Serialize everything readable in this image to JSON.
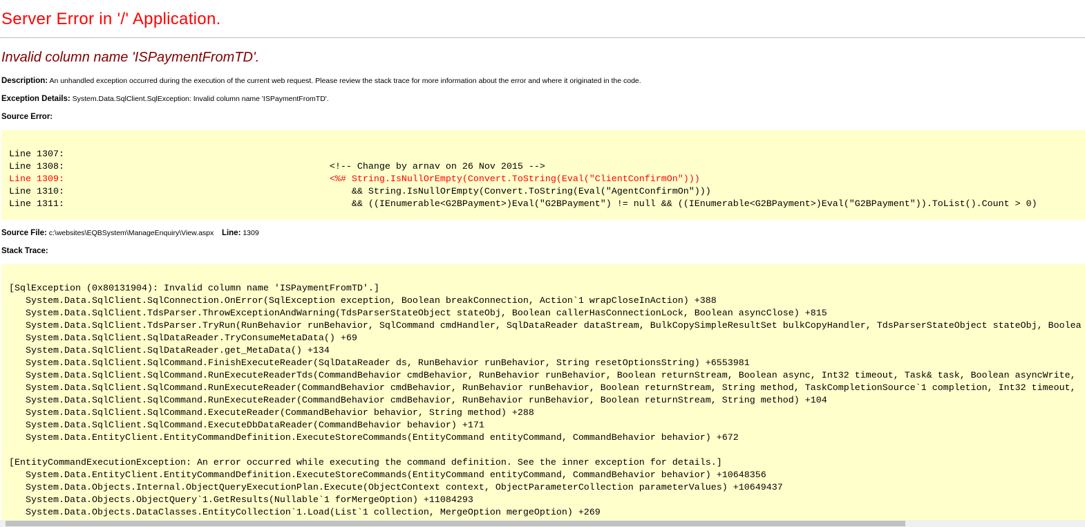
{
  "title": "Server Error in '/' Application.",
  "error_heading": "Invalid column name 'ISPaymentFromTD'.",
  "description": {
    "label": "Description:",
    "text": "An unhandled exception occurred during the execution of the current web request. Please review the stack trace for more information about the error and where it originated in the code."
  },
  "exception": {
    "label": "Exception Details:",
    "text": "System.Data.SqlClient.SqlException: Invalid column name 'ISPaymentFromTD'."
  },
  "source_error_label": "Source Error:",
  "source_lines": [
    "Line 1307:",
    "Line 1308:                                                <!-- Change by arnav on 26 Nov 2015 -->",
    "Line 1309:                                                <%# String.IsNullOrEmpty(Convert.ToString(Eval(\"ClientConfirmOn\")))",
    "Line 1310:                                                    && String.IsNullOrEmpty(Convert.ToString(Eval(\"AgentConfirmOn\")))",
    "Line 1311:                                                    && ((IEnumerable<G2BPayment>)Eval(\"G2BPayment\") != null && ((IEnumerable<G2BPayment>)Eval(\"G2BPayment\")).ToList().Count > 0)"
  ],
  "source_file": {
    "label": "Source File:",
    "path": "c:\\websites\\EQBSystem\\ManageEnquiry\\View.aspx",
    "line_label": "Line:",
    "line": "1309"
  },
  "stack_trace_label": "Stack Trace:",
  "stack_lines": [
    "[SqlException (0x80131904): Invalid column name 'ISPaymentFromTD'.]",
    "   System.Data.SqlClient.SqlConnection.OnError(SqlException exception, Boolean breakConnection, Action`1 wrapCloseInAction) +388",
    "   System.Data.SqlClient.TdsParser.ThrowExceptionAndWarning(TdsParserStateObject stateObj, Boolean callerHasConnectionLock, Boolean asyncClose) +815",
    "   System.Data.SqlClient.TdsParser.TryRun(RunBehavior runBehavior, SqlCommand cmdHandler, SqlDataReader dataStream, BulkCopySimpleResultSet bulkCopyHandler, TdsParserStateObject stateObj, Boolea",
    "   System.Data.SqlClient.SqlDataReader.TryConsumeMetaData() +69",
    "   System.Data.SqlClient.SqlDataReader.get_MetaData() +134",
    "   System.Data.SqlClient.SqlCommand.FinishExecuteReader(SqlDataReader ds, RunBehavior runBehavior, String resetOptionsString) +6553981",
    "   System.Data.SqlClient.SqlCommand.RunExecuteReaderTds(CommandBehavior cmdBehavior, RunBehavior runBehavior, Boolean returnStream, Boolean async, Int32 timeout, Task& task, Boolean asyncWrite,",
    "   System.Data.SqlClient.SqlCommand.RunExecuteReader(CommandBehavior cmdBehavior, RunBehavior runBehavior, Boolean returnStream, String method, TaskCompletionSource`1 completion, Int32 timeout,",
    "   System.Data.SqlClient.SqlCommand.RunExecuteReader(CommandBehavior cmdBehavior, RunBehavior runBehavior, Boolean returnStream, String method) +104",
    "   System.Data.SqlClient.SqlCommand.ExecuteReader(CommandBehavior behavior, String method) +288",
    "   System.Data.SqlClient.SqlCommand.ExecuteDbDataReader(CommandBehavior behavior) +171",
    "   System.Data.EntityClient.EntityCommandDefinition.ExecuteStoreCommands(EntityCommand entityCommand, CommandBehavior behavior) +672",
    "",
    "[EntityCommandExecutionException: An error occurred while executing the command definition. See the inner exception for details.]",
    "   System.Data.EntityClient.EntityCommandDefinition.ExecuteStoreCommands(EntityCommand entityCommand, CommandBehavior behavior) +10648356",
    "   System.Data.Objects.Internal.ObjectQueryExecutionPlan.Execute(ObjectContext context, ObjectParameterCollection parameterValues) +10649437",
    "   System.Data.Objects.ObjectQuery`1.GetResults(Nullable`1 forMergeOption) +11084293",
    "   System.Data.Objects.DataClasses.EntityCollection`1.Load(List`1 collection, MergeOption mergeOption) +269"
  ]
}
